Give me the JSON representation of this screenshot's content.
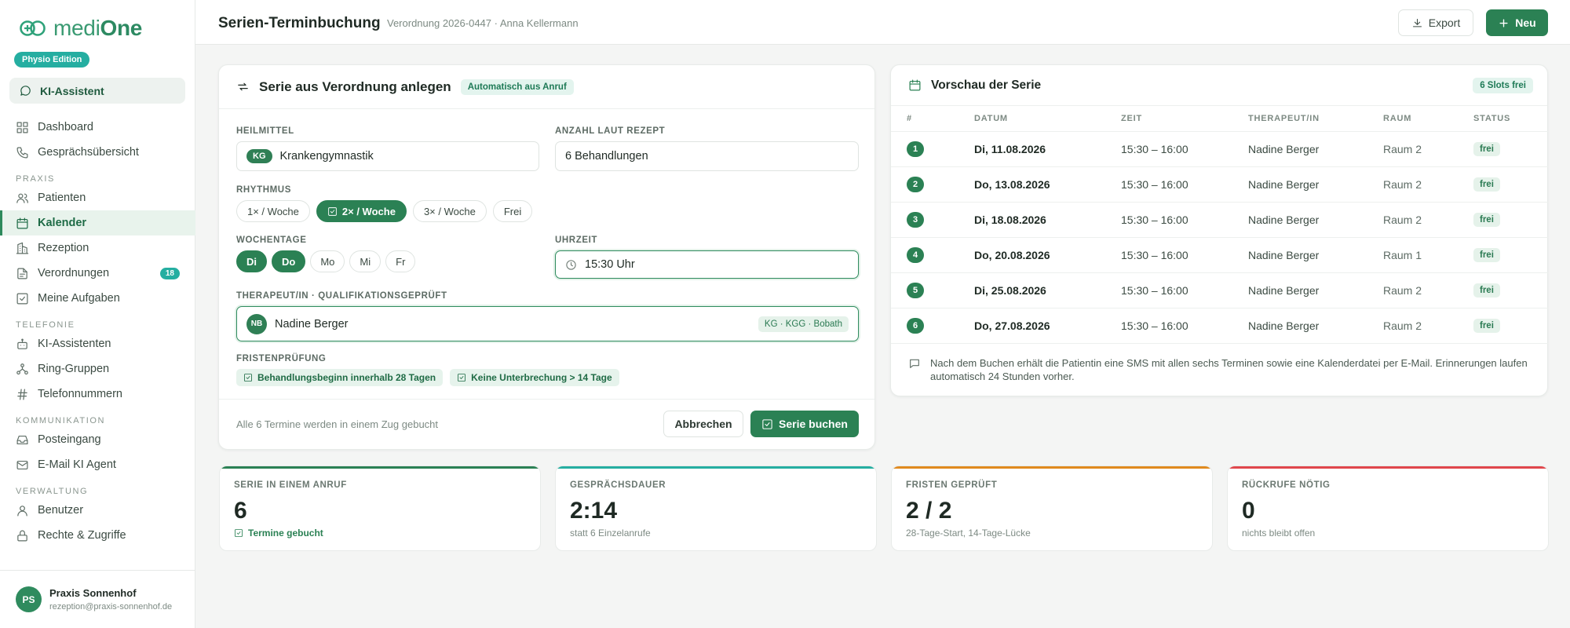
{
  "brand": {
    "logo_light": "medi",
    "logo_bold": "One",
    "edition": "Physio Edition",
    "ki_label": "KI-Assistent"
  },
  "nav": {
    "top": [
      {
        "label": "Dashboard",
        "icon": "grid-icon"
      },
      {
        "label": "Gesprächsübersicht",
        "icon": "phone-icon"
      }
    ],
    "praxis_title": "PRAXIS",
    "praxis": [
      {
        "label": "Patienten",
        "icon": "users-icon"
      },
      {
        "label": "Kalender",
        "icon": "calendar-icon",
        "active": true
      },
      {
        "label": "Rezeption",
        "icon": "building-icon"
      },
      {
        "label": "Verordnungen",
        "icon": "file-icon",
        "badge": "18"
      },
      {
        "label": "Meine Aufgaben",
        "icon": "check-square-icon"
      }
    ],
    "telefonie_title": "TELEFONIE",
    "telefonie": [
      {
        "label": "KI-Assistenten",
        "icon": "robot-icon"
      },
      {
        "label": "Ring-Gruppen",
        "icon": "group-icon"
      },
      {
        "label": "Telefonnummern",
        "icon": "hash-icon"
      }
    ],
    "kommunikation_title": "KOMMUNIKATION",
    "kommunikation": [
      {
        "label": "Posteingang",
        "icon": "inbox-icon"
      },
      {
        "label": "E-Mail KI Agent",
        "icon": "mail-icon"
      }
    ],
    "verwaltung_title": "VERWALTUNG",
    "verwaltung": [
      {
        "label": "Benutzer",
        "icon": "user-icon"
      },
      {
        "label": "Rechte & Zugriffe",
        "icon": "lock-icon"
      }
    ]
  },
  "user": {
    "initials": "PS",
    "name": "Praxis Sonnenhof",
    "email": "rezeption@praxis-sonnenhof.de"
  },
  "header": {
    "title": "Serien-Terminbuchung",
    "subtitle": "Verordnung 2026-0447 · Anna Kellermann",
    "export_label": "Export",
    "new_label": "Neu"
  },
  "form": {
    "title": "Serie aus Verordnung anlegen",
    "auto_chip": "Automatisch aus Anruf",
    "heilmittel_label": "HEILMITTEL",
    "heilmittel_code": "KG",
    "heilmittel_value": "Krankengymnastik",
    "anzahl_label": "ANZAHL LAUT REZEPT",
    "anzahl_value": "6 Behandlungen",
    "rhythmus_label": "RHYTHMUS",
    "rhythmus": [
      {
        "label": "1× / Woche",
        "on": false
      },
      {
        "label": "2× / Woche",
        "on": true
      },
      {
        "label": "3× / Woche",
        "on": false
      },
      {
        "label": "Frei",
        "on": false
      }
    ],
    "wochentage_label": "WOCHENTAGE",
    "wochentage": [
      {
        "label": "Di",
        "on": true
      },
      {
        "label": "Do",
        "on": true
      },
      {
        "label": "Mo",
        "on": false
      },
      {
        "label": "Mi",
        "on": false
      },
      {
        "label": "Fr",
        "on": false
      }
    ],
    "uhrzeit_label": "UHRZEIT",
    "uhrzeit_value": "15:30 Uhr",
    "therapeut_label": "THERAPEUT/IN · QUALIFIKATIONSGEPRÜFT",
    "therapeut_initials": "NB",
    "therapeut_name": "Nadine Berger",
    "therapeut_qual": "KG · KGG · Bobath",
    "fristen_label": "FRISTENPRÜFUNG",
    "fristen": [
      "Behandlungsbeginn innerhalb 28 Tagen",
      "Keine Unterbrechung > 14 Tage"
    ],
    "foot_note": "Alle 6 Termine werden in einem Zug gebucht",
    "cancel_label": "Abbrechen",
    "book_label": "Serie buchen"
  },
  "preview": {
    "title": "Vorschau der Serie",
    "slots_chip": "6 Slots frei",
    "columns": [
      "#",
      "DATUM",
      "ZEIT",
      "THERAPEUT/IN",
      "RAUM",
      "STATUS"
    ],
    "rows": [
      {
        "n": "1",
        "date": "Di, 11.08.2026",
        "time": "15:30 – 16:00",
        "ther": "Nadine Berger",
        "room": "Raum 2",
        "status": "frei"
      },
      {
        "n": "2",
        "date": "Do, 13.08.2026",
        "time": "15:30 – 16:00",
        "ther": "Nadine Berger",
        "room": "Raum 2",
        "status": "frei"
      },
      {
        "n": "3",
        "date": "Di, 18.08.2026",
        "time": "15:30 – 16:00",
        "ther": "Nadine Berger",
        "room": "Raum 2",
        "status": "frei"
      },
      {
        "n": "4",
        "date": "Do, 20.08.2026",
        "time": "15:30 – 16:00",
        "ther": "Nadine Berger",
        "room": "Raum 1",
        "status": "frei"
      },
      {
        "n": "5",
        "date": "Di, 25.08.2026",
        "time": "15:30 – 16:00",
        "ther": "Nadine Berger",
        "room": "Raum 2",
        "status": "frei"
      },
      {
        "n": "6",
        "date": "Do, 27.08.2026",
        "time": "15:30 – 16:00",
        "ther": "Nadine Berger",
        "room": "Raum 2",
        "status": "frei"
      }
    ],
    "note": "Nach dem Buchen erhält die Patientin eine SMS mit allen sechs Terminen sowie eine Kalenderdatei per E-Mail. Erinnerungen laufen automatisch 24 Stunden vorher."
  },
  "kpis": [
    {
      "label": "SERIE IN EINEM ANRUF",
      "value": "6",
      "sub": "Termine gebucht",
      "color": "#2b8154",
      "green": true
    },
    {
      "label": "GESPRÄCHSDAUER",
      "value": "2:14",
      "sub": "statt 6 Einzelanrufe",
      "color": "#25aea1",
      "green": false
    },
    {
      "label": "FRISTEN GEPRÜFT",
      "value": "2 / 2",
      "sub": "28-Tage-Start, 14-Tage-Lücke",
      "color": "#e08a1e",
      "green": false
    },
    {
      "label": "RÜCKRUFE NÖTIG",
      "value": "0",
      "sub": "nichts bleibt offen",
      "color": "#e0474c",
      "green": false
    }
  ],
  "colors": {
    "accent": "#2b8154",
    "teal": "#25aea1"
  }
}
